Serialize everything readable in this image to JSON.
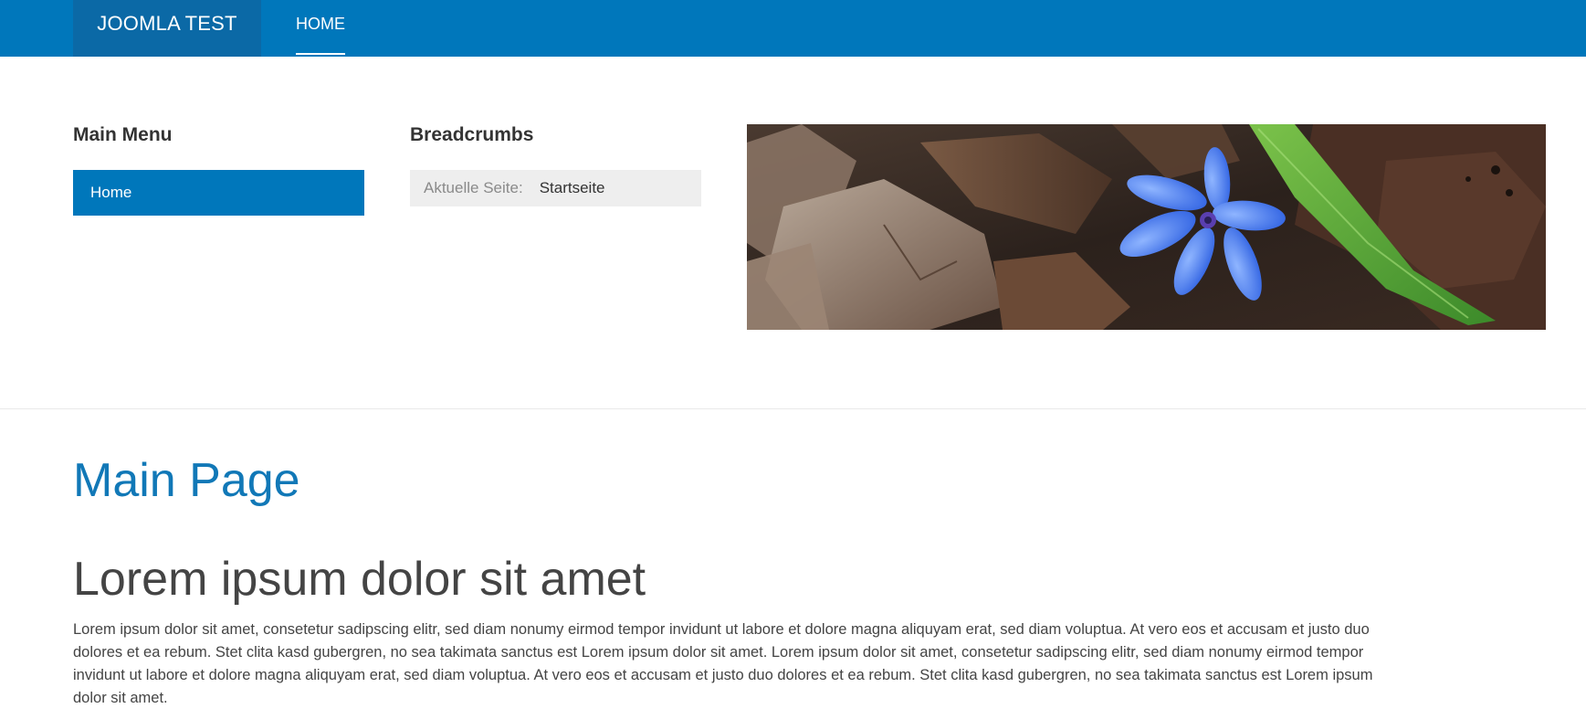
{
  "navbar": {
    "brand": "JOOMLA TEST",
    "items": [
      {
        "label": "HOME",
        "active": true
      }
    ],
    "color": "#0077bb"
  },
  "main_menu": {
    "title": "Main Menu",
    "items": [
      {
        "label": "Home",
        "active": true
      }
    ]
  },
  "breadcrumbs": {
    "title": "Breadcrumbs",
    "prefix": "Aktuelle Seite:",
    "current": "Startseite"
  },
  "banner": {
    "alt": "blue-flower-on-dry-leaves-image"
  },
  "content": {
    "page_heading": "Main Page",
    "article_title": "Lorem ipsum dolor sit amet",
    "article_body": "Lorem ipsum dolor sit amet, consetetur sadipscing elitr, sed diam nonumy eirmod tempor invidunt ut labore et dolore magna aliquyam erat, sed diam voluptua. At vero eos et accusam et justo duo dolores et ea rebum. Stet clita kasd gubergren, no sea takimata sanctus est Lorem ipsum dolor sit amet. Lorem ipsum dolor sit amet, consetetur sadipscing elitr, sed diam nonumy eirmod tempor invidunt ut labore et dolore magna aliquyam erat, sed diam voluptua. At vero eos et accusam et justo duo dolores et ea rebum. Stet clita kasd gubergren, no sea takimata sanctus est Lorem ipsum dolor sit amet."
  },
  "colors": {
    "accent": "#0077bb",
    "brand_bg": "#0b69a6",
    "heading_blue": "#1178b7",
    "breadcrumb_bg": "#eeeeee"
  }
}
